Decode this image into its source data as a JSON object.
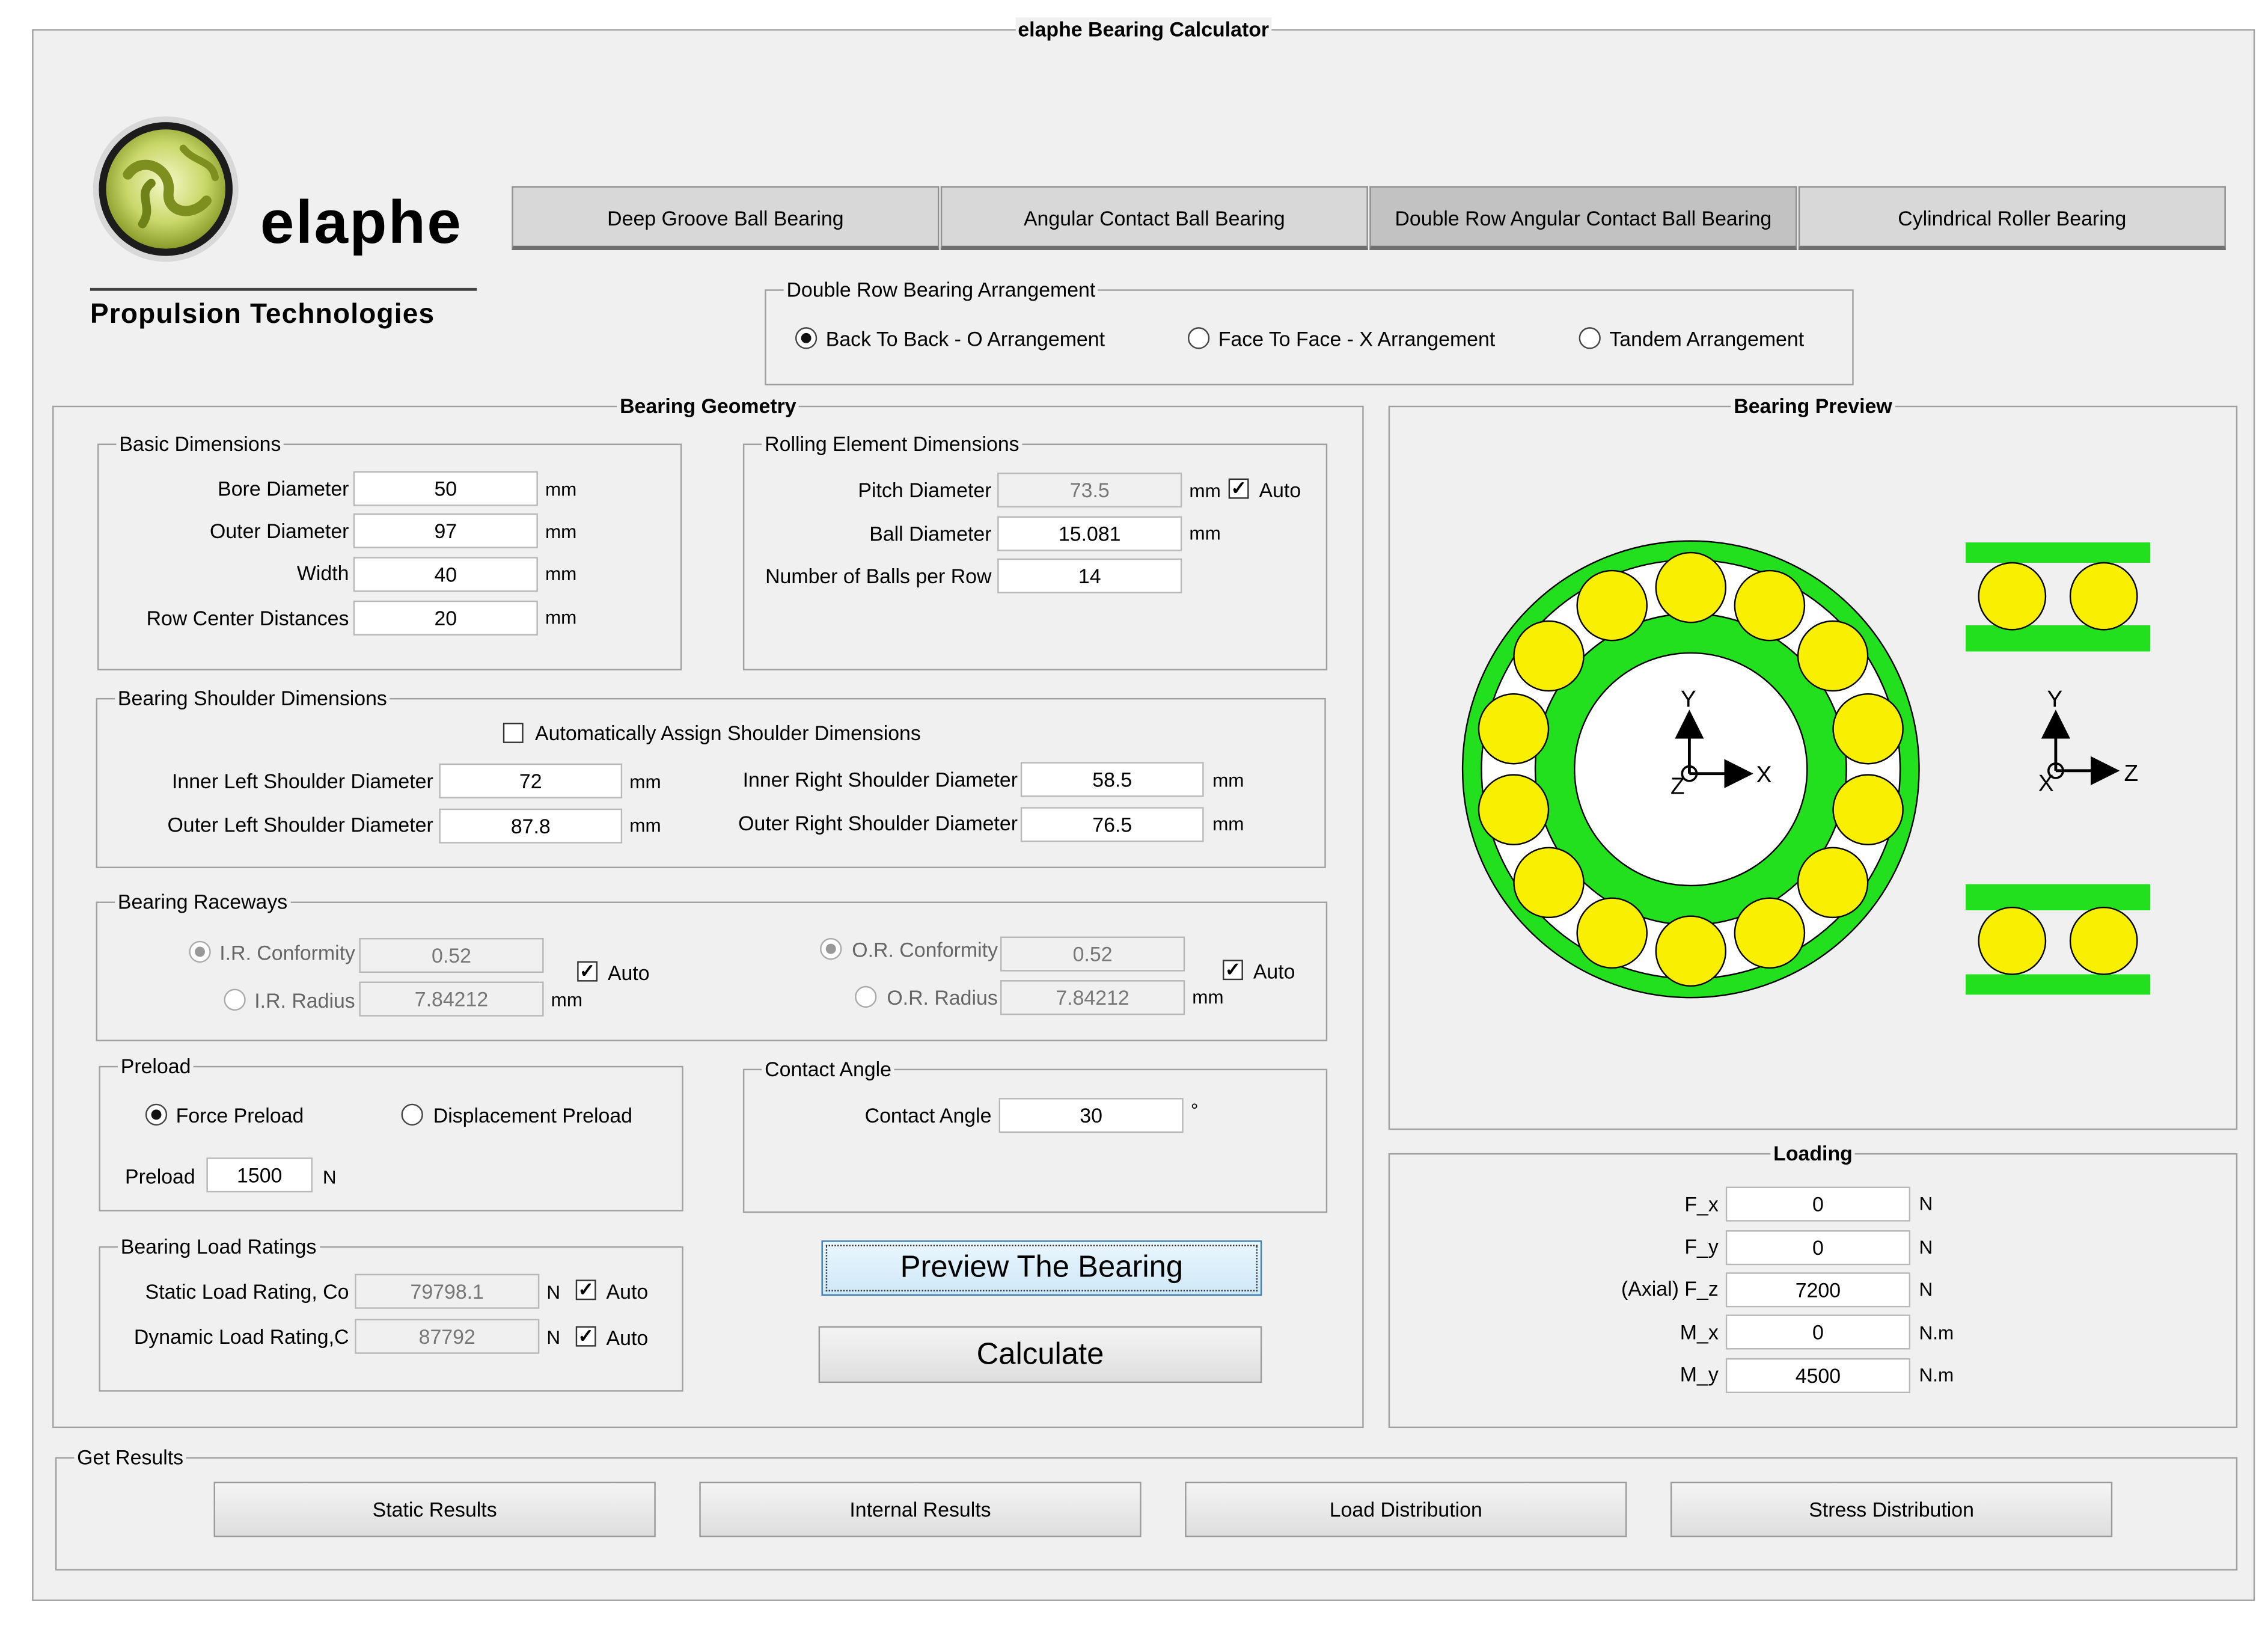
{
  "window": {
    "title": "elaphe Bearing Calculator"
  },
  "brand": {
    "name": "elaphe",
    "tagline": "Propulsion Technologies",
    "colors": {
      "logo_green": "#c8d957",
      "logo_dark": "#1a1a1a"
    }
  },
  "tabs": [
    {
      "label": "Deep Groove Ball Bearing",
      "active": false
    },
    {
      "label": "Angular Contact Ball Bearing",
      "active": false
    },
    {
      "label": "Double Row Angular Contact Ball Bearing",
      "active": true
    },
    {
      "label": "Cylindrical Roller Bearing",
      "active": false
    }
  ],
  "arrangement": {
    "title": "Double Row Bearing Arrangement",
    "options": [
      {
        "label": "Back To Back - O Arrangement",
        "selected": true
      },
      {
        "label": "Face To Face - X Arrangement",
        "selected": false
      },
      {
        "label": "Tandem Arrangement",
        "selected": false
      }
    ]
  },
  "geometry": {
    "title": "Bearing Geometry",
    "basic": {
      "title": "Basic Dimensions",
      "rows": [
        {
          "label": "Bore Diameter",
          "value": "50",
          "unit": "mm"
        },
        {
          "label": "Outer Diameter",
          "value": "97",
          "unit": "mm"
        },
        {
          "label": "Width",
          "value": "40",
          "unit": "mm"
        },
        {
          "label": "Row Center Distances",
          "value": "20",
          "unit": "mm"
        }
      ]
    },
    "rolling": {
      "title": "Rolling Element Dimensions",
      "pitch": {
        "label": "Pitch Diameter",
        "value": "73.5",
        "unit": "mm",
        "auto_label": "Auto",
        "auto": true
      },
      "ball": {
        "label": "Ball Diameter",
        "value": "15.081",
        "unit": "mm"
      },
      "count": {
        "label": "Number of Balls per Row",
        "value": "14"
      }
    },
    "shoulder": {
      "title": "Bearing Shoulder Dimensions",
      "auto_label": "Automatically Assign Shoulder Dimensions",
      "auto": false,
      "inner_left": {
        "label": "Inner Left Shoulder Diameter",
        "value": "72",
        "unit": "mm"
      },
      "outer_left": {
        "label": "Outer Left Shoulder Diameter",
        "value": "87.8",
        "unit": "mm"
      },
      "inner_right": {
        "label": "Inner Right Shoulder Diameter",
        "value": "58.5",
        "unit": "mm"
      },
      "outer_right": {
        "label": "Outer Right Shoulder Diameter",
        "value": "76.5",
        "unit": "mm"
      }
    },
    "raceways": {
      "title": "Bearing Raceways",
      "ir_conf": {
        "label": "I.R. Conformity",
        "value": "0.52"
      },
      "ir_radius": {
        "label": "I.R. Radius",
        "value": "7.84212",
        "unit": "mm"
      },
      "or_conf": {
        "label": "O.R. Conformity",
        "value": "0.52"
      },
      "or_radius": {
        "label": "O.R. Radius",
        "value": "7.84212",
        "unit": "mm"
      },
      "auto_label": "Auto"
    },
    "preload": {
      "title": "Preload",
      "force_label": "Force Preload",
      "disp_label": "Displacement Preload",
      "force_selected": true,
      "label": "Preload",
      "value": "1500",
      "unit": "N"
    },
    "contact": {
      "title": "Contact Angle",
      "label": "Contact Angle",
      "value": "30",
      "unit": "°"
    },
    "ratings": {
      "title": "Bearing Load Ratings",
      "static": {
        "label": "Static Load Rating, Co",
        "value": "79798.1",
        "unit": "N",
        "auto_label": "Auto"
      },
      "dynamic": {
        "label": "Dynamic Load Rating,C",
        "value": "87792",
        "unit": "N",
        "auto_label": "Auto"
      }
    },
    "buttons": {
      "preview": "Preview The Bearing",
      "calculate": "Calculate"
    }
  },
  "preview": {
    "title": "Bearing Preview",
    "balls_per_row": 14,
    "axes": {
      "front_x": "X",
      "front_y": "Y",
      "front_z": "Z",
      "side_z": "Z",
      "side_y": "Y",
      "side_x": "X"
    },
    "colors": {
      "ring": "#22e01e",
      "ball": "#f8f000"
    }
  },
  "loading": {
    "title": "Loading",
    "rows": [
      {
        "label": "F_x",
        "value": "0",
        "unit": "N"
      },
      {
        "label": "F_y",
        "value": "0",
        "unit": "N"
      },
      {
        "label": "(Axial) F_z",
        "value": "7200",
        "unit": "N"
      },
      {
        "label": "M_x",
        "value": "0",
        "unit": "N.m"
      },
      {
        "label": "M_y",
        "value": "4500",
        "unit": "N.m"
      }
    ]
  },
  "results": {
    "title": "Get Results",
    "buttons": [
      "Static Results",
      "Internal Results",
      "Load Distribution",
      "Stress Distribution"
    ]
  }
}
